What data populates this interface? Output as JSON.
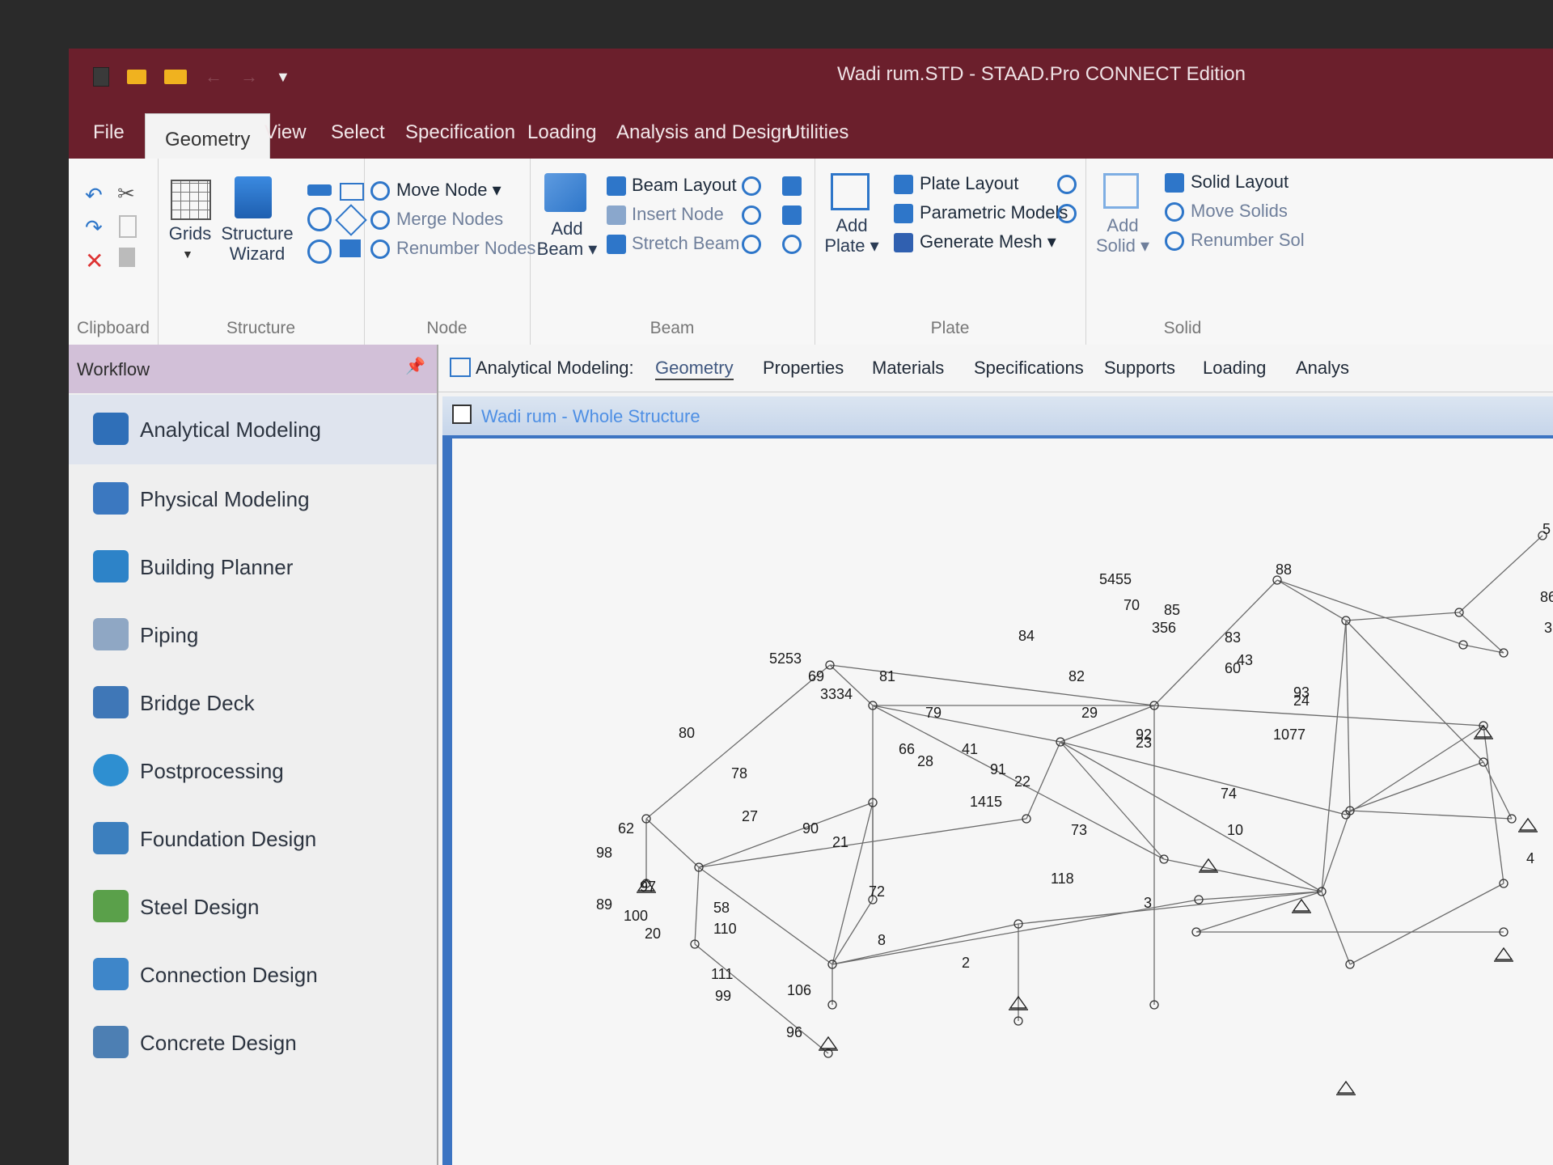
{
  "window": {
    "title": "Wadi rum.STD - STAAD.Pro CONNECT Edition"
  },
  "menu": {
    "tabs": [
      "File",
      "Geometry",
      "View",
      "Select",
      "Specification",
      "Loading",
      "Analysis and Design",
      "Utilities"
    ],
    "active": "Geometry"
  },
  "ribbon": {
    "clipboard": {
      "label": "Clipboard"
    },
    "structure": {
      "label": "Structure",
      "grids": "Grids",
      "wizard_line1": "Structure",
      "wizard_line2": "Wizard"
    },
    "node": {
      "label": "Node",
      "move": "Move Node",
      "merge": "Merge Nodes",
      "renumber": "Renumber Nodes"
    },
    "beam": {
      "label": "Beam",
      "add_line1": "Add",
      "add_line2": "Beam",
      "layout": "Beam Layout",
      "insert": "Insert Node",
      "stretch": "Stretch Beam"
    },
    "plate": {
      "label": "Plate",
      "add_line1": "Add",
      "add_line2": "Plate",
      "layout": "Plate Layout",
      "parametric": "Parametric Models",
      "mesh": "Generate Mesh"
    },
    "solid": {
      "label": "Solid",
      "add_line1": "Add",
      "add_line2": "Solid",
      "layout": "Solid Layout",
      "move": "Move Solids",
      "renumber": "Renumber Sol"
    }
  },
  "workflow": {
    "title": "Workflow",
    "items": [
      {
        "label": "Analytical Modeling",
        "icon": "analytical-modeling-icon",
        "color": "#2f6fb8"
      },
      {
        "label": "Physical Modeling",
        "icon": "physical-modeling-icon",
        "color": "#3b78c0"
      },
      {
        "label": "Building Planner",
        "icon": "building-planner-icon",
        "color": "#2d83c8"
      },
      {
        "label": "Piping",
        "icon": "piping-icon",
        "color": "#8fa7c4"
      },
      {
        "label": "Bridge Deck",
        "icon": "bridge-deck-icon",
        "color": "#3f77b7"
      },
      {
        "label": "Postprocessing",
        "icon": "postprocessing-icon",
        "color": "#2e8fd1"
      },
      {
        "label": "Foundation Design",
        "icon": "foundation-design-icon",
        "color": "#3c7fbe"
      },
      {
        "label": "Steel Design",
        "icon": "steel-design-icon",
        "color": "#5aa04a"
      },
      {
        "label": "Connection Design",
        "icon": "connection-design-icon",
        "color": "#3e86c9"
      },
      {
        "label": "Concrete Design",
        "icon": "concrete-design-icon",
        "color": "#4d7fb3"
      }
    ]
  },
  "analytical_tabs": {
    "prefix": "Analytical Modeling:",
    "tabs": [
      "Geometry",
      "Properties",
      "Materials",
      "Specifications",
      "Supports",
      "Loading",
      "Analys"
    ],
    "active": "Geometry"
  },
  "viewport": {
    "title": "Wadi rum - Whole Structure",
    "labels": [
      "5",
      "5455",
      "88",
      "70",
      "85",
      "86",
      "3",
      "356",
      "84",
      "83",
      "43",
      "82",
      "60",
      "5253",
      "69",
      "81",
      "3334",
      "79",
      "29",
      "93",
      "24",
      "1077",
      "80",
      "41",
      "66",
      "28",
      "91",
      "92",
      "23",
      "22",
      "1415",
      "74",
      "78",
      "62",
      "27",
      "90",
      "21",
      "98",
      "73",
      "10",
      "4",
      "118",
      "97",
      "89",
      "3",
      "72",
      "58",
      "100",
      "110",
      "20",
      "8",
      "2",
      "111",
      "99",
      "106",
      "96"
    ]
  }
}
